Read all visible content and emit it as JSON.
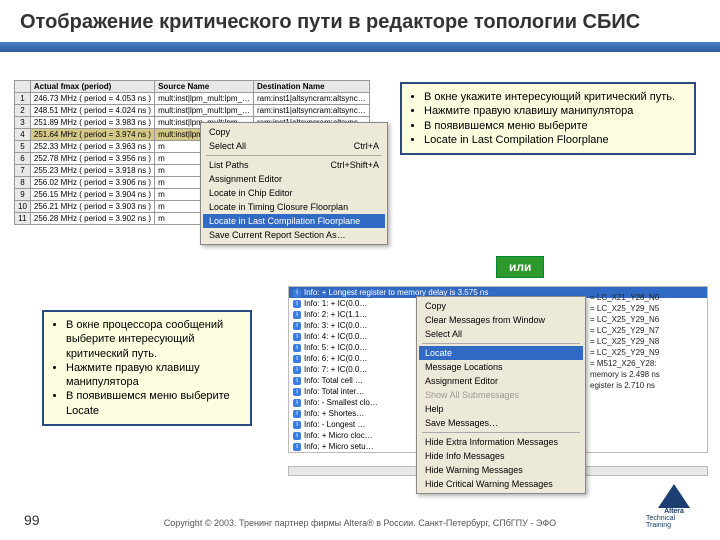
{
  "title": "Отображение критического пути в редакторе топологии СБИС",
  "table1": {
    "headers": [
      "",
      "Actual fmax (period)",
      "Source Name",
      "Destination Name"
    ],
    "rows": [
      [
        "1",
        "246.73 MHz ( period = 4.053 ns )",
        "mult:inst|lpm_mult:lpm_…",
        "ram:inst1|altsyncram:altsync…"
      ],
      [
        "2",
        "248.51 MHz ( period = 4.024 ns )",
        "mult:inst|lpm_mult:lpm_…",
        "ram:inst1|altsyncram:altsync…"
      ],
      [
        "3",
        "251.89 MHz ( period = 3.983 ns )",
        "mult:inst|lpm_mult:lpm_…",
        "ram:inst1|altsyncram:altsync…"
      ],
      [
        "4",
        "251.64 MHz ( period = 3.974 ns )",
        "mult:inst|lpm_mult:lpm_…",
        "ram:inst1|altsyncram:altsync…"
      ],
      [
        "5",
        "252.33 MHz ( period = 3.963 ns )",
        "m",
        ""
      ],
      [
        "6",
        "252.78 MHz ( period = 3.956 ns )",
        "m",
        ""
      ],
      [
        "7",
        "255.23 MHz ( period = 3.918 ns )",
        "m",
        ""
      ],
      [
        "8",
        "256.02 MHz ( period = 3.906 ns )",
        "m",
        ""
      ],
      [
        "9",
        "256.15 MHz ( period = 3.904 ns )",
        "m",
        ""
      ],
      [
        "10",
        "256.21 MHz ( period = 3.903 ns )",
        "m",
        ""
      ],
      [
        "11",
        "256.28 MHz ( period = 3.902 ns )",
        "m",
        ""
      ]
    ]
  },
  "menu1": {
    "items": [
      {
        "label": "Copy",
        "short": ""
      },
      {
        "label": "Select All",
        "short": "Ctrl+A"
      },
      {
        "sep": true
      },
      {
        "label": "List Paths",
        "short": "Ctrl+Shift+A"
      },
      {
        "label": "Assignment Editor",
        "short": ""
      },
      {
        "label": "Locate in Chip Editor",
        "short": ""
      },
      {
        "label": "Locate in Timing Closure Floorplan",
        "short": ""
      },
      {
        "label": "Locate in Last Compilation Floorplane",
        "short": "",
        "hl": true
      },
      {
        "label": "Save Current Report Section As…",
        "short": ""
      }
    ]
  },
  "callout1": {
    "lines": [
      "В окне укажите интересующий критический путь.",
      "Нажмите правую клавишу манипулятора",
      "В появившемся меню выберите",
      "  Locate in Last Compilation Floorplane"
    ]
  },
  "callout2": {
    "lines": [
      "В окне процессора сообщений выберите интересующий критический путь.",
      "Нажмите правую клавишу манипулятора",
      "В появившемся меню выберите Locate"
    ]
  },
  "or_label": "или",
  "msgpane": {
    "header": "Info: + Longest register to memory delay is 3.575 ns",
    "lines": [
      "Info: 1: + IC(0.0…",
      "Info: 2: + IC(1.1…",
      "Info: 3: + IC(0.0…",
      "Info: 4: + IC(0.0…",
      "Info: 5: + IC(0.0…",
      "Info: 6: + IC(0.0…",
      "Info: 7: + IC(0.0…",
      "Info: Total cell …",
      "Info: Total inter…",
      "Info: - Smallest clo…",
      "Info: + Shortes…",
      "Info: - Longest …",
      "Info: + Micro cloc…",
      "Info: + Micro setu…"
    ],
    "right": [
      "= LC_X21_Y28_N0",
      "= LC_X25_Y29_N5",
      "= LC_X25_Y29_N6",
      "= LC_X25_Y29_N7",
      "= LC_X25_Y29_N8",
      "= LC_X25_Y29_N9",
      "= M512_X26_Y28:",
      "",
      "",
      "",
      "memory is 2.498 ns",
      "egister is 2.710 ns"
    ]
  },
  "menu2": {
    "items": [
      {
        "label": "Copy"
      },
      {
        "label": "Clear Messages from Window"
      },
      {
        "label": "Select All"
      },
      {
        "sep": true
      },
      {
        "label": "Locate",
        "hl": true
      },
      {
        "label": "Message Locations"
      },
      {
        "label": "Assignment Editor"
      },
      {
        "label": "Show All Submessages",
        "disabled": true
      },
      {
        "label": "Help"
      },
      {
        "label": "Save Messages…"
      },
      {
        "sep": true
      },
      {
        "label": "Hide Extra Information Messages"
      },
      {
        "label": "Hide Info Messages"
      },
      {
        "label": "Hide Warning Messages"
      },
      {
        "label": "Hide Critical Warning Messages"
      }
    ]
  },
  "footer": "Copyright © 2003. Тренинг партнер фирмы Altera®   в России. Санкт-Петербург, СПбГПУ - ЭФО",
  "pagenum": "99",
  "logo": {
    "line1": "Altera",
    "line2": "Technical Training"
  }
}
